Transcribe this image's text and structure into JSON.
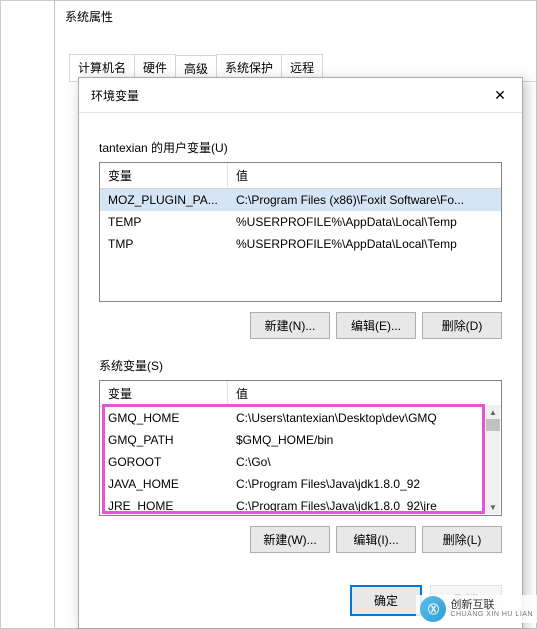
{
  "outer": {
    "title": "系统属性",
    "tabs": [
      "计算机名",
      "硬件",
      "高级",
      "系统保护",
      "远程"
    ],
    "active_tab_index": 2
  },
  "inner": {
    "title": "环境变量",
    "close_symbol": "✕"
  },
  "user_section": {
    "label": "tantexian 的用户变量(U)",
    "columns": {
      "name": "变量",
      "value": "值"
    },
    "rows": [
      {
        "name": "MOZ_PLUGIN_PA...",
        "value": "C:\\Program Files (x86)\\Foxit Software\\Fo...",
        "selected": true
      },
      {
        "name": "TEMP",
        "value": "%USERPROFILE%\\AppData\\Local\\Temp",
        "selected": false
      },
      {
        "name": "TMP",
        "value": "%USERPROFILE%\\AppData\\Local\\Temp",
        "selected": false
      }
    ],
    "buttons": {
      "new": "新建(N)...",
      "edit": "编辑(E)...",
      "delete": "删除(D)"
    }
  },
  "system_section": {
    "label": "系统变量(S)",
    "columns": {
      "name": "变量",
      "value": "值"
    },
    "rows": [
      {
        "name": "GMQ_HOME",
        "value": "C:\\Users\\tantexian\\Desktop\\dev\\GMQ"
      },
      {
        "name": "GMQ_PATH",
        "value": "$GMQ_HOME/bin"
      },
      {
        "name": "GOROOT",
        "value": "C:\\Go\\"
      },
      {
        "name": "JAVA_HOME",
        "value": "C:\\Program Files\\Java\\jdk1.8.0_92"
      },
      {
        "name": "JRE_HOME",
        "value": "C:\\Program Files\\Java\\jdk1.8.0_92\\jre"
      }
    ],
    "buttons": {
      "new": "新建(W)...",
      "edit": "编辑(I)...",
      "delete": "删除(L)"
    }
  },
  "dialog_buttons": {
    "ok": "确定",
    "cancel": "取消"
  },
  "watermark": {
    "brand": "创新互联",
    "sub": "CHUANG XIN HU LIAN"
  }
}
